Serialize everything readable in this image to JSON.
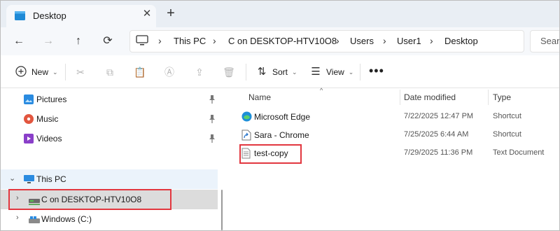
{
  "window": {
    "tab_title": "Desktop",
    "close_glyph": "✕",
    "new_tab_glyph": "+"
  },
  "address_bar": {
    "crumbs": [
      "This PC",
      "C on DESKTOP-HTV10O8",
      "Users",
      "User1",
      "Desktop"
    ],
    "separator": "›",
    "search_placeholder": "Search"
  },
  "nav_buttons": {
    "back": "←",
    "forward": "→",
    "up": "↑",
    "refresh": "⟳"
  },
  "command_bar": {
    "new_label": "New",
    "sort_label": "Sort",
    "view_label": "View",
    "more_glyph": "•••",
    "caret": "⌄"
  },
  "nav_pane": {
    "quick_access": [
      {
        "label": "Pictures",
        "icon": "pictures-icon"
      },
      {
        "label": "Music",
        "icon": "music-icon"
      },
      {
        "label": "Videos",
        "icon": "videos-icon"
      }
    ],
    "this_pc": "This PC",
    "drives": [
      {
        "label": "C on DESKTOP-HTV10O8",
        "icon": "network-drive-icon",
        "highlighted": true
      },
      {
        "label": "Windows (C:)",
        "icon": "local-drive-icon",
        "highlighted": false
      }
    ],
    "pin_glyph": "📌",
    "expanded_glyph": "⌄",
    "collapsed_glyph": "›"
  },
  "file_list": {
    "columns": [
      "Name",
      "Date modified",
      "Type"
    ],
    "rows": [
      {
        "name": "Microsoft Edge",
        "date": "7/22/2025 12:47 PM",
        "type": "Shortcut",
        "icon": "edge-icon"
      },
      {
        "name": "Sara - Chrome",
        "date": "7/25/2025 6:44 AM",
        "type": "Shortcut",
        "icon": "shortcut-icon"
      },
      {
        "name": "test-copy",
        "date": "7/29/2025 11:36 PM",
        "type": "Text Document",
        "icon": "text-file-icon",
        "highlighted": true
      }
    ]
  },
  "colors": {
    "highlight_box": "#e2373f",
    "tab_bar": "#e9eef4",
    "selected_nav": "#ebf3fb",
    "active_drive": "#dcdcdc"
  }
}
